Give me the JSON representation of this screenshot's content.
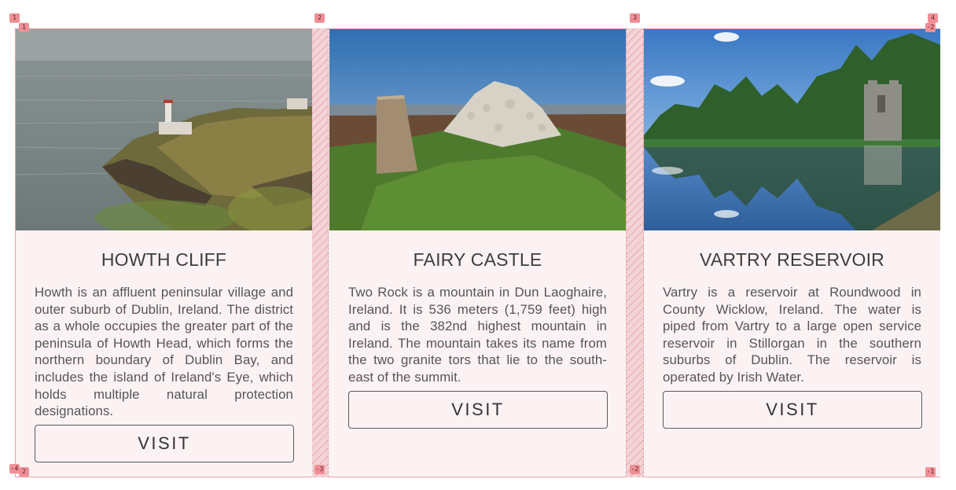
{
  "cards": [
    {
      "title": "HOWTH CLIFF",
      "description": "Howth is an affluent peninsular village and outer suburb of Dublin, Ireland. The district as a whole occupies the greater part of the peninsula of Howth Head, which forms the northern boundary of Dublin Bay, and includes the island of Ireland's Eye, which holds multiple natural protection designations.",
      "button_label": "VISIT",
      "image": "howth-cliff-lighthouse-photo"
    },
    {
      "title": "FAIRY CASTLE",
      "description": "Two Rock is a mountain in Dun Laoghaire, Ireland. It is 536 meters (1,759 feet) high and is the 382nd highest mountain in Ireland. The mountain takes its name from the two granite tors that lie to the south-east of the summit.",
      "button_label": "VISIT",
      "image": "fairy-castle-cairn-photo"
    },
    {
      "title": "VARTRY RESERVOIR",
      "description": "Vartry is a reservoir at Roundwood in County Wicklow, Ireland. The water is piped from Vartry to a large open service reservoir in Stillorgan in the southern suburbs of Dublin. The reservoir is operated by Irish Water.",
      "button_label": "VISIT",
      "image": "vartry-reservoir-photo"
    }
  ],
  "grid_overlay": {
    "column_lines": [
      "1",
      "2",
      "3",
      "4"
    ],
    "row_lines": [
      "1",
      "-2"
    ],
    "column_lines_negative": [
      "-4",
      "-3",
      "-2",
      "-1"
    ],
    "row_lines_negative": [
      "2",
      "-1"
    ],
    "color": "#ef8f95"
  }
}
